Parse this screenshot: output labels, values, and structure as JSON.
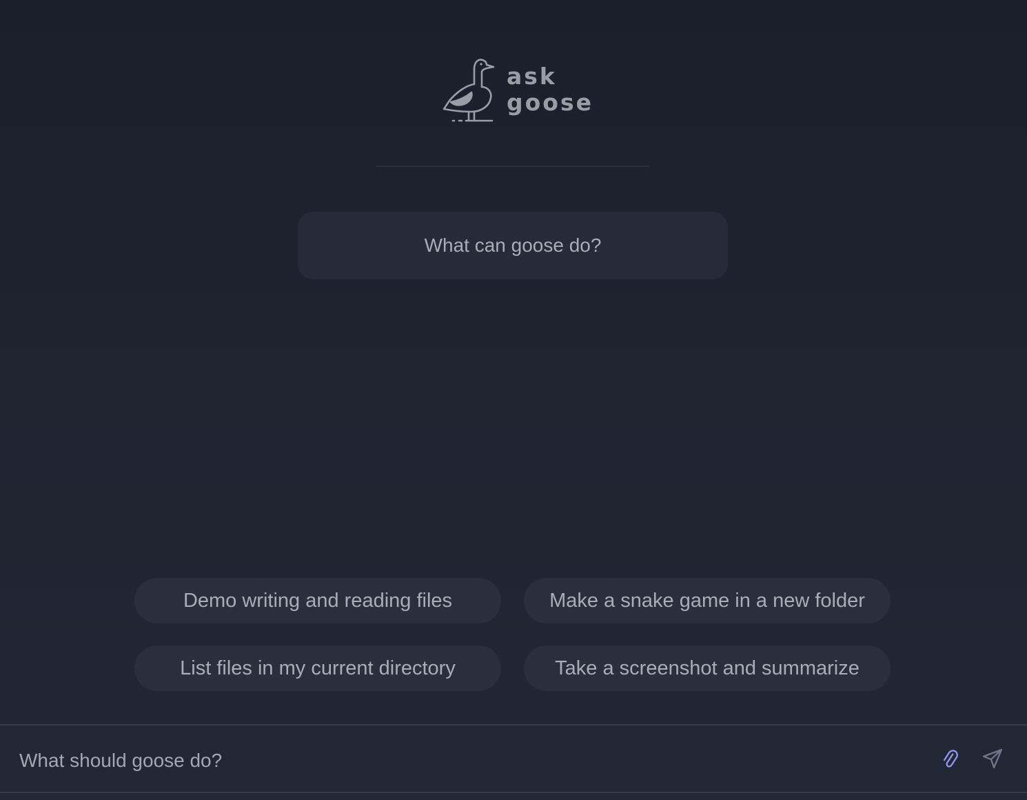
{
  "logo": {
    "line1": "ask",
    "line2": "goose",
    "icon": "goose-icon"
  },
  "hero": {
    "label": "What can goose do?"
  },
  "suggestions": [
    {
      "label": "Demo writing and reading files"
    },
    {
      "label": "Make a snake game in a new folder"
    },
    {
      "label": "List files in my current directory"
    },
    {
      "label": "Take a screenshot and summarize"
    }
  ],
  "input": {
    "placeholder": "What should goose do?",
    "value": ""
  },
  "icons": {
    "attach": "paperclip-icon",
    "send": "send-icon"
  },
  "colors": {
    "background": "#1f2431",
    "card": "#262b39",
    "pill": "#2a2f3d",
    "text": "#a9adb6",
    "attach_accent": "#8e95f0"
  }
}
